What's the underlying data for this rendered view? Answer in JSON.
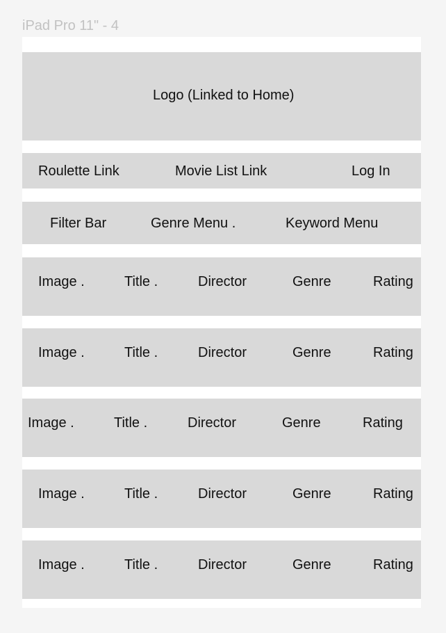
{
  "frame_title": "iPad Pro 11\" - 4",
  "header": {
    "logo_label": "Logo (Linked to Home)"
  },
  "nav": {
    "roulette_label": "Roulette Link",
    "movie_list_label": "Movie List Link",
    "login_label": "Log In"
  },
  "filter": {
    "filter_bar_label": "Filter Bar",
    "genre_menu_label": "Genre Menu .",
    "keyword_menu_label": "Keyword Menu"
  },
  "movie_rows": [
    {
      "image": "Image .",
      "title": "Title .",
      "director": "Director",
      "genre": "Genre",
      "rating": "Rating"
    },
    {
      "image": "Image .",
      "title": "Title .",
      "director": "Director",
      "genre": "Genre",
      "rating": "Rating"
    },
    {
      "image": "Image .",
      "title": "Title .",
      "director": "Director",
      "genre": "Genre",
      "rating": "Rating"
    },
    {
      "image": "Image .",
      "title": "Title .",
      "director": "Director",
      "genre": "Genre",
      "rating": "Rating"
    },
    {
      "image": "Image .",
      "title": "Title .",
      "director": "Director",
      "genre": "Genre",
      "rating": "Rating"
    }
  ],
  "colors": {
    "canvas": "#f5f5f5",
    "frame": "#ffffff",
    "block": "#d9d9d9",
    "text": "#111111",
    "frame_label": "#c2c2c2"
  }
}
